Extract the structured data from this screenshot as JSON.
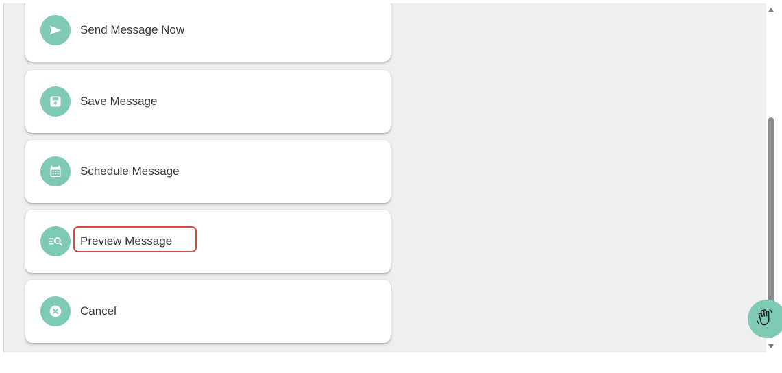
{
  "actions": [
    {
      "label": "Send Message Now",
      "icon": "send-icon"
    },
    {
      "label": "Save Message",
      "icon": "save-icon"
    },
    {
      "label": "Schedule Message",
      "icon": "calendar-icon"
    },
    {
      "label": "Preview Message",
      "icon": "preview-search-icon"
    },
    {
      "label": "Cancel",
      "icon": "cancel-icon"
    }
  ],
  "colors": {
    "accent": "#7ecab5",
    "highlight": "#d24b3d",
    "background": "#efefef",
    "card": "#ffffff",
    "text": "#3a3a3a"
  },
  "help_widget": {
    "icon": "waving-hand-icon"
  }
}
